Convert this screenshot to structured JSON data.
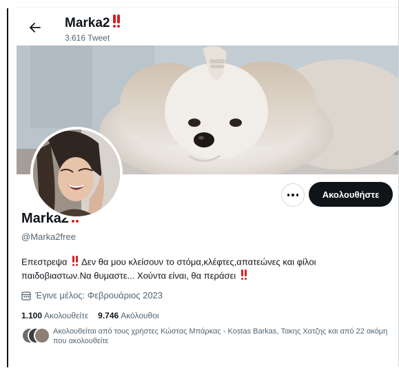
{
  "header": {
    "title": "Marka2",
    "subtitle": "3.616 Tweet"
  },
  "profile": {
    "display_name": "Marka2",
    "handle": "@Marka2free",
    "bio_line1_a": "Επεστρεψα",
    "bio_line1_b": "Δεν θα μου κλείσουν το στόμα,κλέφτες,απατεώνες και φίλοι",
    "bio_line2": "παιδοβιαστων.Να θυμαστε... Χούντα είναι, θα περάσει",
    "joined": "Έγινε μέλος: Φεβρουάριος 2023",
    "following_count": "1.100",
    "following_label": "Ακολουθείτε",
    "followers_count": "9.746",
    "followers_label": "Ακόλουθοι",
    "followed_by": "Ακολουθείται από τους χρήστες Κώστας Μπάρκας - Kostas Barkas, Τακης Χατζης και από 22 ακόμη που ακολουθείτε"
  },
  "actions": {
    "more_icon": "more-horizontal-icon",
    "follow_label": "Ακολουθήστε"
  },
  "icons": {
    "back": "arrow-left-icon",
    "calendar": "calendar-icon",
    "emoji": "double-exclamation-icon"
  },
  "colors": {
    "accent": "#0f1419",
    "secondary_text": "#536471",
    "emoji_red": "#d61f26"
  }
}
